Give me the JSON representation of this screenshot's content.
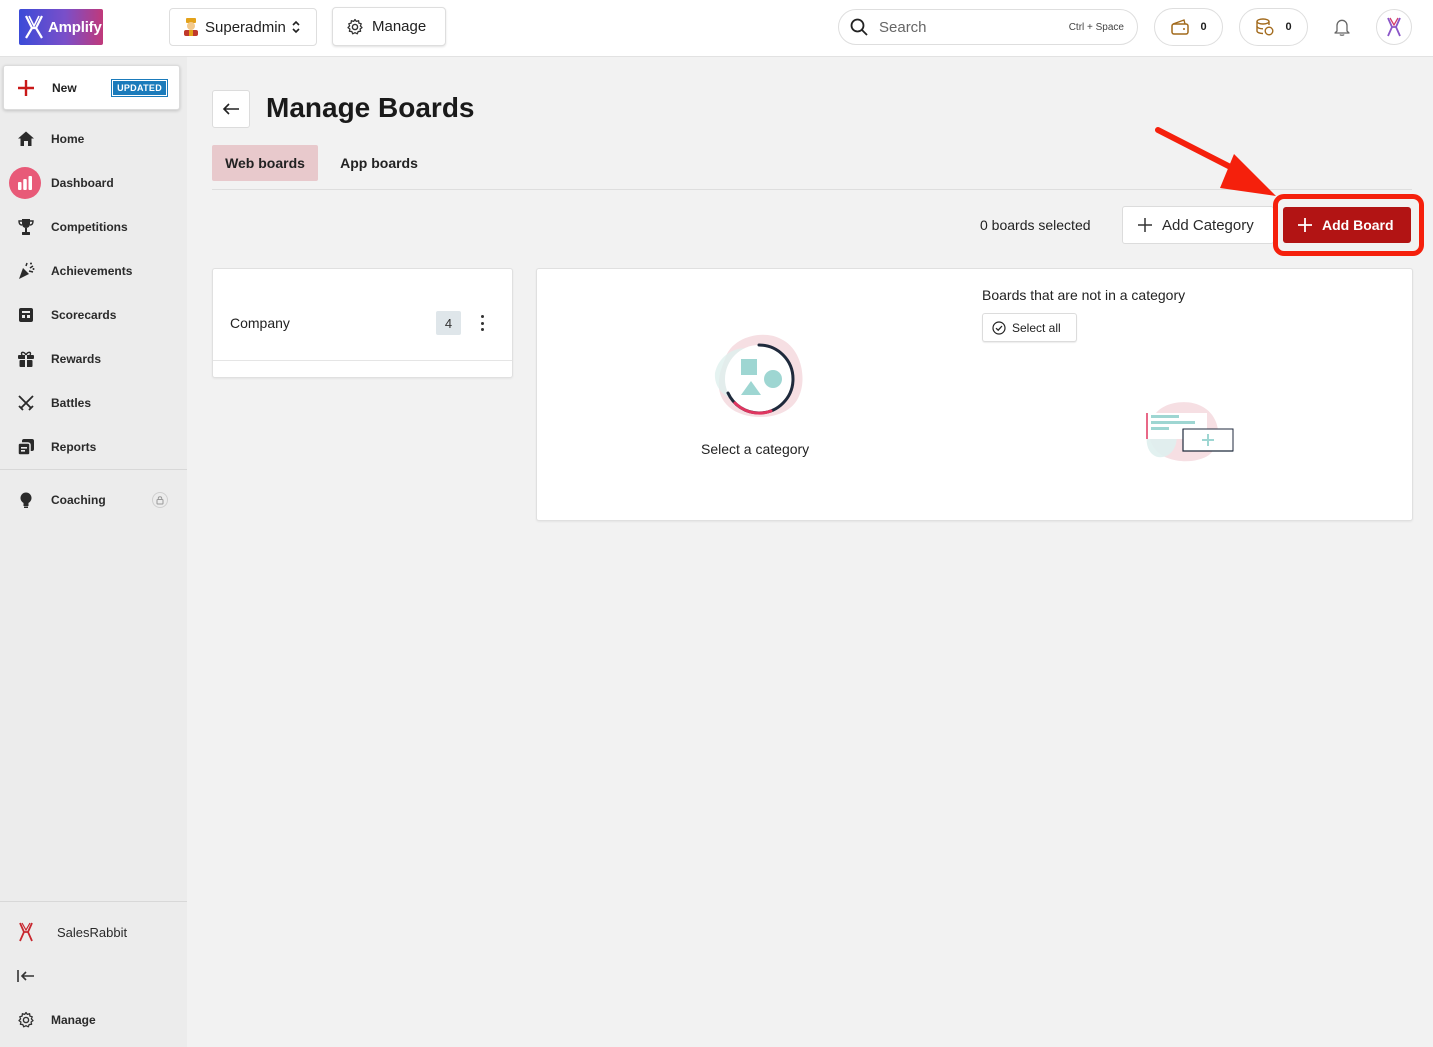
{
  "app": {
    "logo_text": "Amplify"
  },
  "topbar": {
    "user_switch": {
      "label": "Superadmin"
    },
    "manage_label": "Manage",
    "search": {
      "placeholder": "Search",
      "shortcut": "Ctrl + Space"
    },
    "wallet_count": "0",
    "coins_count": "0"
  },
  "sidebar": {
    "new_label": "New",
    "new_badge": "UPDATED",
    "items": [
      {
        "label": "Home",
        "icon": "home-icon"
      },
      {
        "label": "Dashboard",
        "icon": "bar-chart-icon",
        "active": true
      },
      {
        "label": "Competitions",
        "icon": "trophy-icon"
      },
      {
        "label": "Achievements",
        "icon": "party-popper-icon"
      },
      {
        "label": "Scorecards",
        "icon": "scorecard-icon"
      },
      {
        "label": "Rewards",
        "icon": "gift-icon"
      },
      {
        "label": "Battles",
        "icon": "crossed-swords-icon"
      },
      {
        "label": "Reports",
        "icon": "reports-icon"
      },
      {
        "label": "Coaching",
        "icon": "lightbulb-icon",
        "locked": true
      }
    ],
    "org_label": "SalesRabbit",
    "manage_label": "Manage"
  },
  "main": {
    "title": "Manage Boards",
    "tabs": [
      {
        "label": "Web boards",
        "active": true
      },
      {
        "label": "App boards",
        "active": false
      }
    ],
    "selected_count": "0 boards selected",
    "add_category_label": "Add Category",
    "add_board_label": "Add Board",
    "categories": [
      {
        "name": "Company",
        "count": "4"
      }
    ],
    "empty_category_text": "Select a category",
    "uncategorized_title": "Boards that are not in a category",
    "select_all_label": "Select all"
  },
  "colors": {
    "accent": "#b21414",
    "highlight": "#f5200c",
    "active_tab": "#e8c9cc",
    "badge": "#1b7bbb"
  }
}
